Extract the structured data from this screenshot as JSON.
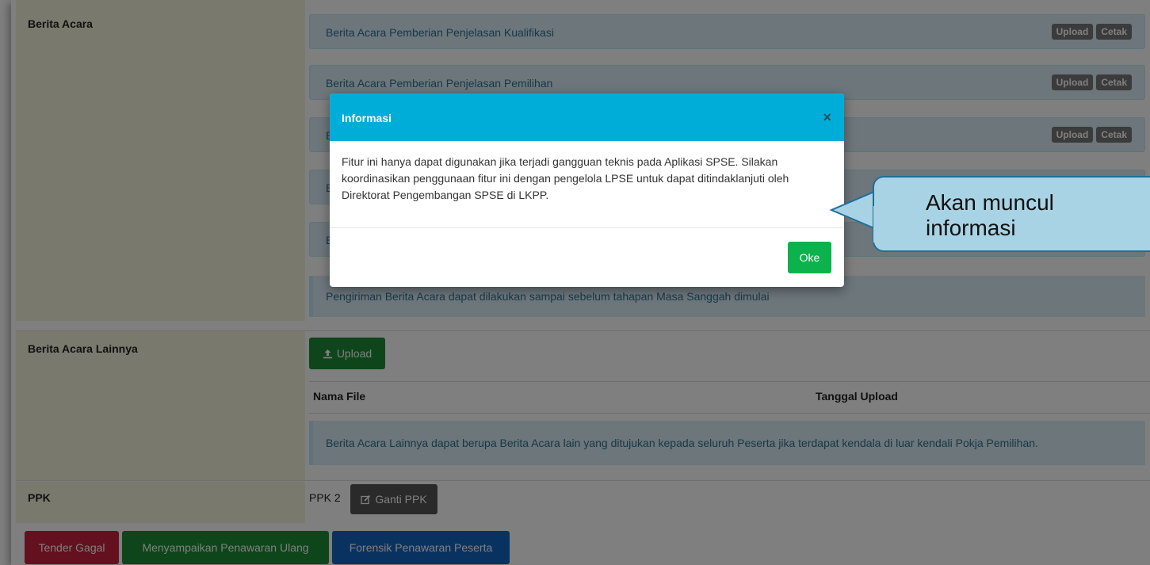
{
  "berita_acara": {
    "label": "Berita Acara",
    "items": [
      {
        "title": "Berita Acara Pemberian Penjelasan Kualifikasi",
        "upload": "Upload",
        "cetak": "Cetak"
      },
      {
        "title": "Berita Acara Pemberian Penjelasan Pemilihan",
        "upload": "Upload",
        "cetak": "Cetak"
      },
      {
        "title": "B",
        "upload": "Upload",
        "cetak": "Cetak"
      },
      {
        "title": "B"
      },
      {
        "title": "B"
      }
    ],
    "note": "Pengiriman Berita Acara dapat dilakukan sampai sebelum tahapan Masa Sanggah dimulai"
  },
  "berita_acara_lainnya": {
    "label": "Berita Acara Lainnya",
    "upload_button": "Upload",
    "columns": [
      "Nama File",
      "Tanggal Upload"
    ],
    "note": "Berita Acara Lainnya dapat berupa Berita Acara lain yang ditujukan kepada seluruh Peserta jika terdapat kendala di luar kendali Pokja Pemilihan."
  },
  "ppk": {
    "label": "PPK",
    "value": "PPK 2",
    "ganti_button": "Ganti PPK"
  },
  "actions": {
    "tender_gagal": "Tender Gagal",
    "menyampaikan": "Menyampaikan Penawaran Ulang",
    "forensik": "Forensik Penawaran Peserta"
  },
  "modal": {
    "title": "Informasi",
    "close": "×",
    "body": "Fitur ini hanya dapat digunakan jika terjadi gangguan teknis pada Aplikasi SPSE. Silakan koordinasikan penggunaan fitur ini dengan pengelola LPSE untuk dapat ditindaklanjuti oleh Direktorat Pengembangan SPSE di LKPP.",
    "ok": "Oke"
  },
  "callout": {
    "text": "Akan muncul informasi"
  },
  "colors": {
    "modal_header": "#00add8",
    "ok_button": "#0cb24b",
    "danger": "#c9203d",
    "success": "#1e8a36",
    "primary": "#1565c0"
  },
  "icons": {
    "upload": "upload-icon",
    "edit": "edit-icon",
    "close": "close-icon"
  }
}
